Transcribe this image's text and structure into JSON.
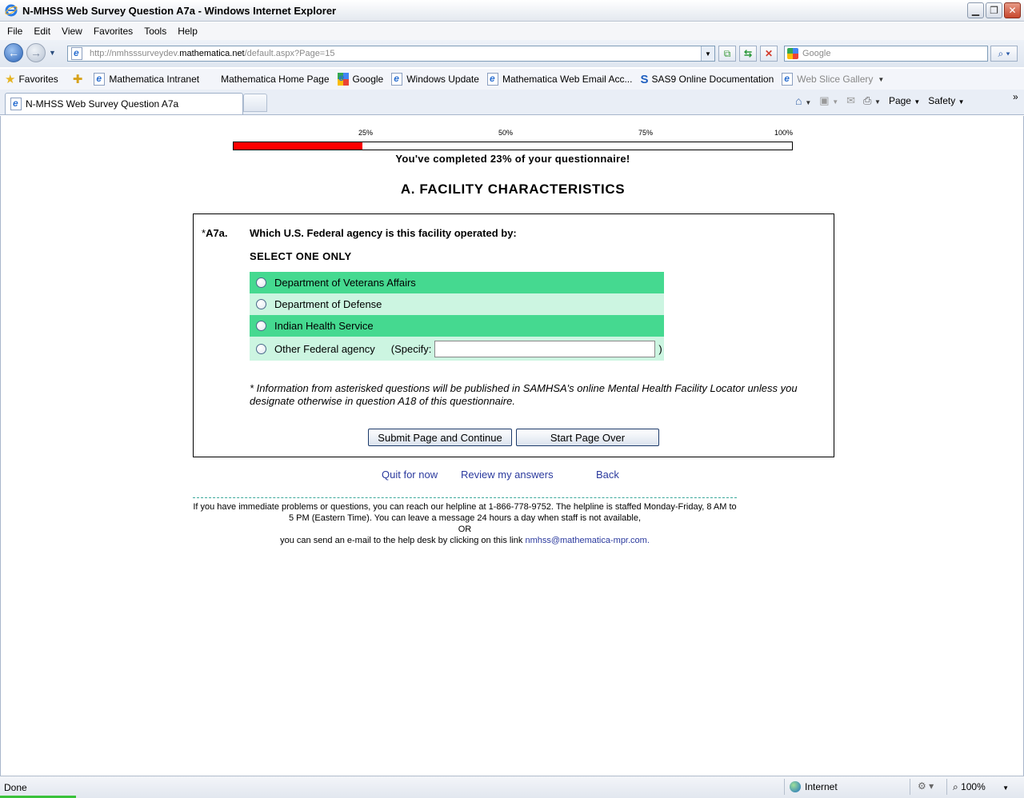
{
  "window": {
    "title": "N-MHSS Web Survey Question A7a - Windows Internet Explorer"
  },
  "menu": [
    "File",
    "Edit",
    "View",
    "Favorites",
    "Tools",
    "Help"
  ],
  "address": {
    "url_prefix": "http://nmhsssurveydev.",
    "url_domain": "mathematica.net",
    "url_suffix": "/default.aspx?Page=15"
  },
  "search": {
    "placeholder": "Google"
  },
  "favorites": {
    "label": "Favorites",
    "items": [
      "Mathematica Intranet",
      "Mathematica Home Page",
      "Google",
      "Windows Update",
      "Mathematica Web Email Acc...",
      "SAS9 Online Documentation",
      "Web Slice Gallery"
    ]
  },
  "tab": {
    "title": "N-MHSS Web Survey Question A7a"
  },
  "commandbar": {
    "page": "Page",
    "safety": "Safety"
  },
  "progress": {
    "labels": [
      "25%",
      "50%",
      "75%",
      "100%"
    ],
    "percent": 23,
    "text": "You've completed 23% of your questionnaire!"
  },
  "section": {
    "title": "A. FACILITY CHARACTERISTICS"
  },
  "question": {
    "asterisk": "*",
    "number": "A7a.",
    "text": "Which U.S. Federal agency is this facility operated by:",
    "instruction": "SELECT ONE ONLY",
    "options": [
      "Department of Veterans Affairs",
      "Department of Defense",
      "Indian Health Service",
      "Other Federal agency"
    ],
    "specify_label": "(Specify:",
    "specify_close": ")",
    "specify_value": "",
    "note": "* Information from asterisked questions will be published in SAMHSA's online Mental Health Facility Locator unless you designate otherwise in question A18 of this questionnaire."
  },
  "buttons": {
    "submit": "Submit Page and Continue",
    "reset": "Start Page Over"
  },
  "links": {
    "quit": "Quit for now",
    "review": "Review my answers",
    "back": "Back"
  },
  "help": {
    "line1": "If you have immediate problems or questions, you can reach our helpline at 1-866-778-9752. The helpline is staffed Monday-Friday, 8 AM to 5 PM (Eastern Time). You can leave a message 24 hours a day when staff is not available,",
    "or": "OR",
    "line3": "you can send an e-mail to the help desk by clicking on this link",
    "email": "nmhss@mathematica-mpr.com."
  },
  "status": {
    "text": "Done",
    "zone": "Internet",
    "zoom": "100%"
  },
  "colors": {
    "progress_fill": "#ff0000",
    "option_dark": "#45d990",
    "option_light": "#ccf5e1",
    "link": "#2b3a9e"
  }
}
